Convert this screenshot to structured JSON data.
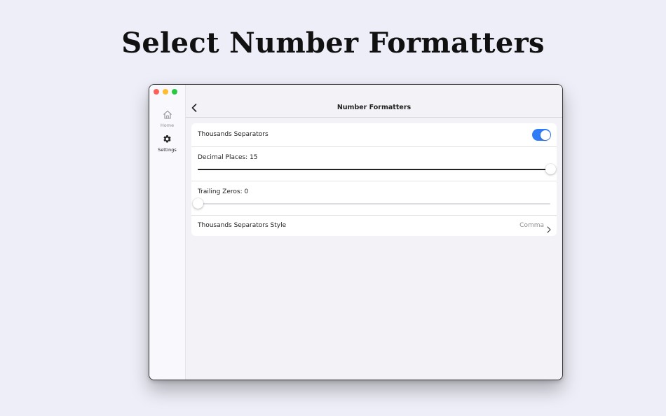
{
  "headline": "Select Number Formatters",
  "sidebar": {
    "items": [
      {
        "label": "Home",
        "icon": "house-icon"
      },
      {
        "label": "Settings",
        "icon": "gear-icon"
      }
    ]
  },
  "nav": {
    "title": "Number Formatters"
  },
  "settings": {
    "thousands_separators": {
      "label": "Thousands Separators",
      "enabled": true
    },
    "decimal_places": {
      "label": "Decimal Places: 15",
      "value": 15,
      "min": 0,
      "max": 15
    },
    "trailing_zeros": {
      "label": "Trailing Zeros: 0",
      "value": 0,
      "min": 0,
      "max": 15
    },
    "separator_style": {
      "label": "Thousands Separators Style",
      "value": "Comma"
    }
  },
  "colors": {
    "accent": "#2f7cf6",
    "background": "#eeeef8",
    "slider_fill": "#222222"
  }
}
